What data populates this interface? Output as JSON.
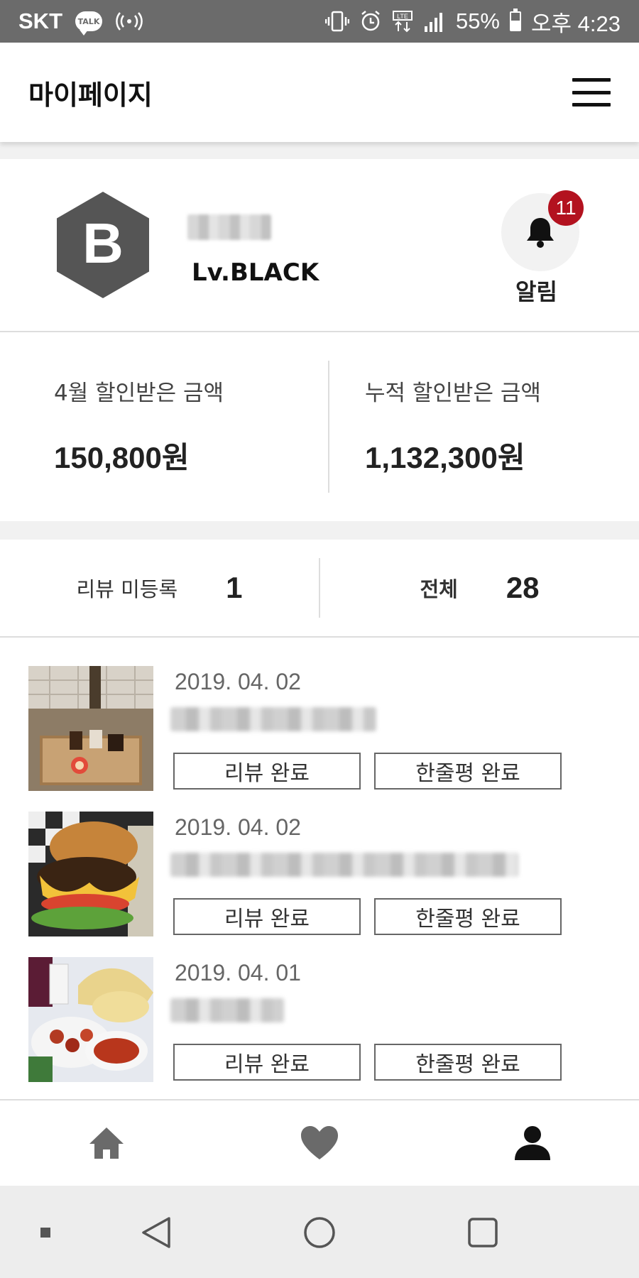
{
  "status_bar": {
    "carrier": "SKT",
    "talk_badge": "TALK",
    "network": "LTE",
    "battery": "55%",
    "battery_level": 0.55,
    "time": "오후 4:23"
  },
  "header": {
    "title": "마이페이지",
    "menu_icon": "hamburger-menu-icon"
  },
  "profile": {
    "badge_letter": "B",
    "badge_color": "#555555",
    "level": "Lv.BLACK",
    "notification_count": "11",
    "notification_label": "알림",
    "notification_badge_color": "#B3121F"
  },
  "discounts": {
    "month": {
      "label": "4월 할인받은 금액",
      "amount": "150,800원"
    },
    "total": {
      "label": "누적 할인받은 금액",
      "amount": "1,132,300원"
    }
  },
  "review_counts": {
    "unregistered_label": "리뷰 미등록",
    "unregistered_value": "1",
    "total_label": "전체",
    "total_value": "28"
  },
  "orders": [
    {
      "date": "2019. 04. 02",
      "review_button": "리뷰 완료",
      "oneline_button": "한줄평 완료",
      "thumb": "dessert-cafe-photo"
    },
    {
      "date": "2019. 04. 02",
      "review_button": "리뷰 완료",
      "oneline_button": "한줄평 완료",
      "thumb": "cheeseburger-photo"
    },
    {
      "date": "2019. 04. 01",
      "review_button": "리뷰 완료",
      "oneline_button": "한줄평 완료",
      "thumb": "indian-food-photo"
    }
  ],
  "bottom_nav": {
    "items": [
      "home-icon",
      "heart-icon",
      "person-icon"
    ],
    "active": "person-icon"
  },
  "system_nav": {
    "items": [
      "recent-dot-icon",
      "back-icon",
      "home-circle-icon",
      "overview-square-icon"
    ]
  }
}
